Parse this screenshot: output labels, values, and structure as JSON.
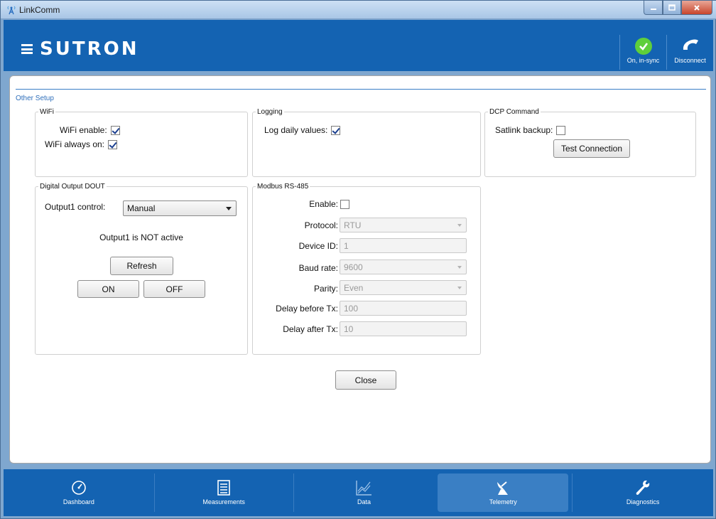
{
  "window": {
    "title": "LinkComm"
  },
  "header": {
    "brand": "SUTRON",
    "sync_label": "On, in-sync",
    "disconnect_label": "Disconnect"
  },
  "section": {
    "title": "Other Setup"
  },
  "wifi": {
    "legend": "WiFi",
    "enable_label": "WiFi enable:",
    "enable_checked": true,
    "always_on_label": "WiFi always on:",
    "always_on_checked": true
  },
  "logging": {
    "legend": "Logging",
    "daily_label": "Log daily values:",
    "daily_checked": true
  },
  "dcp": {
    "legend": "DCP Command",
    "satlink_label": "Satlink backup:",
    "satlink_checked": false,
    "test_button": "Test Connection"
  },
  "dout": {
    "legend": "Digital Output DOUT",
    "control_label": "Output1 control:",
    "control_value": "Manual",
    "status_text": "Output1 is NOT active",
    "refresh_button": "Refresh",
    "on_button": "ON",
    "off_button": "OFF"
  },
  "modbus": {
    "legend": "Modbus RS-485",
    "enable_label": "Enable:",
    "enable_checked": false,
    "protocol_label": "Protocol:",
    "protocol_value": "RTU",
    "device_id_label": "Device ID:",
    "device_id_value": "1",
    "baud_label": "Baud rate:",
    "baud_value": "9600",
    "parity_label": "Parity:",
    "parity_value": "Even",
    "delay_before_label": "Delay before Tx:",
    "delay_before_value": "100",
    "delay_after_label": "Delay after Tx:",
    "delay_after_value": "10"
  },
  "close_button": "Close",
  "nav": {
    "dashboard": "Dashboard",
    "measurements": "Measurements",
    "data": "Data",
    "telemetry": "Telemetry",
    "diagnostics": "Diagnostics",
    "active": "telemetry"
  },
  "colors": {
    "brand_blue": "#1463b2",
    "accent_line": "#3a7ec7",
    "sync_green": "#5fcf3b"
  }
}
